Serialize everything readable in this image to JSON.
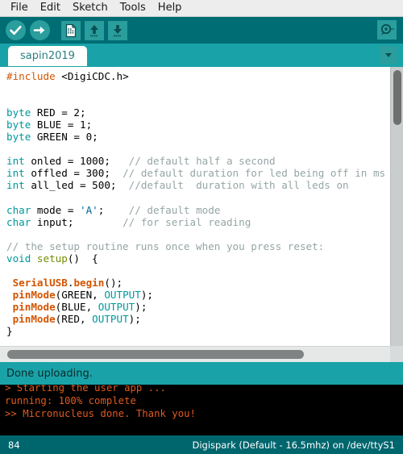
{
  "window": {
    "app": "Arduino IDE"
  },
  "menubar": {
    "items": [
      {
        "label": "File",
        "name": "menu-file"
      },
      {
        "label": "Edit",
        "name": "menu-edit"
      },
      {
        "label": "Sketch",
        "name": "menu-sketch"
      },
      {
        "label": "Tools",
        "name": "menu-tools"
      },
      {
        "label": "Help",
        "name": "menu-help"
      }
    ]
  },
  "toolbar": {
    "verify": {
      "icon": "check-circle-icon",
      "label": "Verify"
    },
    "upload": {
      "icon": "arrow-right-circle-icon",
      "label": "Upload"
    },
    "new": {
      "icon": "new-document-icon",
      "label": "New"
    },
    "open": {
      "icon": "arrow-up-open-icon",
      "label": "Open"
    },
    "save": {
      "icon": "arrow-down-save-icon",
      "label": "Save"
    },
    "serial_monitor": {
      "icon": "serial-monitor-icon",
      "label": "Serial Monitor"
    },
    "background_color": "#006d75",
    "button_color": "#2a9d9d"
  },
  "tabbar": {
    "active_tab": "sapin2019",
    "dropdown_icon": "chevron-down-icon",
    "background_color": "#19a3a8"
  },
  "editor": {
    "colors": {
      "keyword": "#00979c",
      "function": "#d35400",
      "function2": "#728e00",
      "comment": "#95a5a6",
      "preprocessor": "#d35400",
      "string": "#006699",
      "plain": "#000000"
    },
    "lines": [
      [
        {
          "t": "#include ",
          "c": "preprocessor"
        },
        {
          "t": "<DigiCDC.h>",
          "c": "plain"
        }
      ],
      [],
      [],
      [
        {
          "t": "byte ",
          "c": "keyword"
        },
        {
          "t": "RED = 2;",
          "c": "plain"
        }
      ],
      [
        {
          "t": "byte ",
          "c": "keyword"
        },
        {
          "t": "BLUE = 1;",
          "c": "plain"
        }
      ],
      [
        {
          "t": "byte ",
          "c": "keyword"
        },
        {
          "t": "GREEN = 0;",
          "c": "plain"
        }
      ],
      [],
      [
        {
          "t": "int ",
          "c": "keyword"
        },
        {
          "t": "onled = 1000;   ",
          "c": "plain"
        },
        {
          "t": "// default half a second",
          "c": "comment"
        }
      ],
      [
        {
          "t": "int ",
          "c": "keyword"
        },
        {
          "t": "offled = 300;  ",
          "c": "plain"
        },
        {
          "t": "// default duration for led being off in ms",
          "c": "comment"
        }
      ],
      [
        {
          "t": "int ",
          "c": "keyword"
        },
        {
          "t": "all_led = 500;  ",
          "c": "plain"
        },
        {
          "t": "//default  duration with all leds on",
          "c": "comment"
        }
      ],
      [],
      [
        {
          "t": "char ",
          "c": "keyword"
        },
        {
          "t": "mode = ",
          "c": "plain"
        },
        {
          "t": "'A'",
          "c": "string"
        },
        {
          "t": ";    ",
          "c": "plain"
        },
        {
          "t": "// default mode",
          "c": "comment"
        }
      ],
      [
        {
          "t": "char ",
          "c": "keyword"
        },
        {
          "t": "input;        ",
          "c": "plain"
        },
        {
          "t": "// for serial reading",
          "c": "comment"
        }
      ],
      [],
      [
        {
          "t": "// the setup routine runs once when you press reset:",
          "c": "comment"
        }
      ],
      [
        {
          "t": "void ",
          "c": "keyword"
        },
        {
          "t": "setup",
          "c": "function2"
        },
        {
          "t": "()  {",
          "c": "plain"
        }
      ],
      [],
      [
        {
          "t": " ",
          "c": "plain"
        },
        {
          "t": "SerialUSB",
          "c": "function"
        },
        {
          "t": ".",
          "c": "plain"
        },
        {
          "t": "begin",
          "c": "function"
        },
        {
          "t": "();",
          "c": "plain"
        }
      ],
      [
        {
          "t": " ",
          "c": "plain"
        },
        {
          "t": "pinMode",
          "c": "function"
        },
        {
          "t": "(GREEN, ",
          "c": "plain"
        },
        {
          "t": "OUTPUT",
          "c": "keyword"
        },
        {
          "t": ");",
          "c": "plain"
        }
      ],
      [
        {
          "t": " ",
          "c": "plain"
        },
        {
          "t": "pinMode",
          "c": "function"
        },
        {
          "t": "(BLUE, ",
          "c": "plain"
        },
        {
          "t": "OUTPUT",
          "c": "keyword"
        },
        {
          "t": ");",
          "c": "plain"
        }
      ],
      [
        {
          "t": " ",
          "c": "plain"
        },
        {
          "t": "pinMode",
          "c": "function"
        },
        {
          "t": "(RED, ",
          "c": "plain"
        },
        {
          "t": "OUTPUT",
          "c": "keyword"
        },
        {
          "t": ");",
          "c": "plain"
        }
      ],
      [
        {
          "t": "}",
          "c": "plain"
        }
      ]
    ]
  },
  "status_message": {
    "text": "Done uploading."
  },
  "console": {
    "lines": [
      "> Starting the user app ...",
      "running: 100% complete",
      ">> Micronucleus done. Thank you!"
    ],
    "text_color": "#e05a1e",
    "background_color": "#000000"
  },
  "statusbar": {
    "line_number": "84",
    "board_info": "Digispark (Default - 16.5mhz) on /dev/ttyS1"
  }
}
